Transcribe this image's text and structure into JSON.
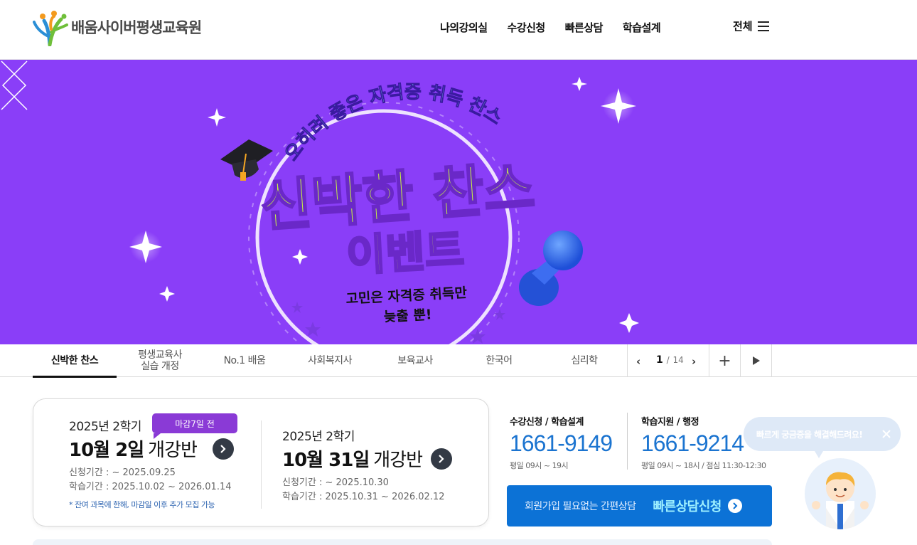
{
  "header": {
    "logo_text": "배움사이버평생교육원",
    "nav": [
      "나의강의실",
      "수강신청",
      "빠른상담",
      "학습설계"
    ],
    "all_menu_label": "전체"
  },
  "banner": {
    "arc_text": "오히려 좋은 자격증 취득 찬스",
    "title_line1": "신박한 찬스",
    "title_line2": "이벤트",
    "sub_line1": "고민은 자격증 취득만",
    "sub_line2": "늦출 뿐!",
    "bg_color": "#8a3ef8",
    "accent_color": "#c8f542"
  },
  "tabs": {
    "items": [
      "신박한 찬스",
      "평생교육사\n실습 개정",
      "No.1 배움",
      "사회복지사",
      "보육교사",
      "한국어",
      "심리학"
    ],
    "active_index": 0
  },
  "pager": {
    "current": "1",
    "separator": "/",
    "total": "14"
  },
  "semesters": {
    "deadline_badge": "마감7일 전",
    "items": [
      {
        "term": "2025년 2학기",
        "open_date": "10월 2일",
        "open_label": "개강반",
        "apply_period": "신청기간 : ~ 2025.09.25",
        "study_period": "학습기간 : 2025.10.02 ~ 2026.01.14"
      },
      {
        "term": "2025년 2학기",
        "open_date": "10월 31일",
        "open_label": "개강반",
        "apply_period": "신청기간 : ~ 2025.10.30",
        "study_period": "학습기간 : 2025.10.31 ~ 2026.02.12"
      }
    ],
    "note": "* 잔여 과목에 한해, 마감일 이후 추가 모집 가능"
  },
  "contacts": [
    {
      "label": "수강신청 / 학습설계",
      "phone": "1661-9149",
      "hours": "평일 09시 ~ 19시"
    },
    {
      "label": "학습지원 / 행정",
      "phone": "1661-9214",
      "hours": "평일 09시 ~ 18시 / 점심 11:30-12:30"
    }
  ],
  "consult": {
    "sub_label": "회원가입 필요없는 간편상담",
    "main_label": "빠른상담신청"
  },
  "chat": {
    "bubble_text": "빠르게 궁금증을 해결해드려요!"
  }
}
